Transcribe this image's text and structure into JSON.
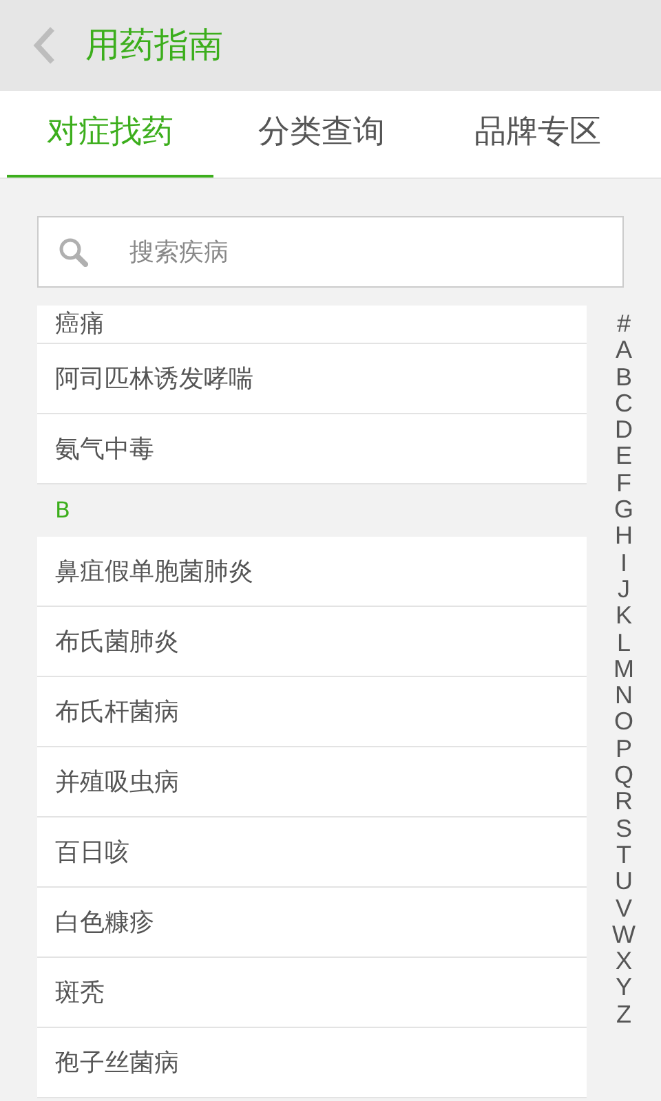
{
  "header": {
    "title": "用药指南"
  },
  "tabs": [
    {
      "label": "对症找药",
      "selected": true
    },
    {
      "label": "分类查询",
      "selected": false
    },
    {
      "label": "品牌专区",
      "selected": false
    }
  ],
  "search": {
    "placeholder": "搜索疾病"
  },
  "list": [
    {
      "kind": "item",
      "label": "癌痛"
    },
    {
      "kind": "item",
      "label": "阿司匹林诱发哮喘"
    },
    {
      "kind": "item",
      "label": "氨气中毒"
    },
    {
      "kind": "section",
      "label": "B"
    },
    {
      "kind": "item",
      "label": "鼻疽假单胞菌肺炎"
    },
    {
      "kind": "item",
      "label": "布氏菌肺炎"
    },
    {
      "kind": "item",
      "label": "布氏杆菌病"
    },
    {
      "kind": "item",
      "label": "并殖吸虫病"
    },
    {
      "kind": "item",
      "label": "百日咳"
    },
    {
      "kind": "item",
      "label": "白色糠疹"
    },
    {
      "kind": "item",
      "label": "斑秃"
    },
    {
      "kind": "item",
      "label": "孢子丝菌病"
    }
  ],
  "index": [
    "#",
    "A",
    "B",
    "C",
    "D",
    "E",
    "F",
    "G",
    "H",
    "I",
    "J",
    "K",
    "L",
    "M",
    "N",
    "O",
    "P",
    "Q",
    "R",
    "S",
    "T",
    "U",
    "V",
    "W",
    "X",
    "Y",
    "Z"
  ]
}
